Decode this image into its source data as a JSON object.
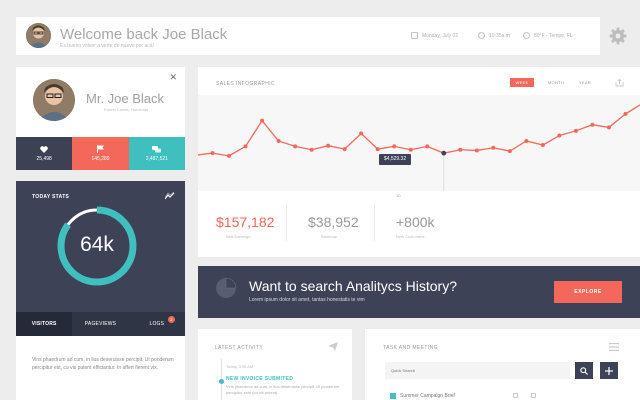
{
  "header": {
    "welcome": "Welcome back Joe Black",
    "subtitle": "Es bueno volver a verte de nuevo por acá!",
    "date": "Monday, July 02",
    "time": "10:35a.m",
    "weather": "80°F - Tempe, FL"
  },
  "profile": {
    "name": "Mr. Joe Black",
    "location": "Puerto Cortés, Honduras",
    "stats": [
      {
        "icon": "heart-icon",
        "value": "25,498"
      },
      {
        "icon": "flag-icon",
        "value": "145,289"
      },
      {
        "icon": "chat-icon",
        "value": "2,487,521"
      }
    ]
  },
  "today": {
    "title": "TODAY STATS",
    "value": "64k",
    "progress": 0.85,
    "tabs": [
      "VISITORS",
      "PAGEVIEWS",
      "LOGS"
    ],
    "active_tab": "VISITORS",
    "logs_badge": "2",
    "description": "Viris phaedrum ad cum, in lius deseruisse percipit. Ut ponderum percipitur est, cu vis putent efficiantur. In affert fierent vix."
  },
  "sales": {
    "title": "SALES INFOGRAPHIC",
    "periods": [
      "WEEK",
      "MONTH",
      "YEAR"
    ],
    "active_period": "WEEK",
    "tooltip": "$4,529.32",
    "x_label": "10",
    "kpis": [
      {
        "value": "$157,182",
        "label": "Total Earnings",
        "color": "#f3685a"
      },
      {
        "value": "$38,952",
        "label": "Revenue",
        "color": "#9a9a9a"
      },
      {
        "value": "+800k",
        "label": "New Customers",
        "color": "#9a9a9a"
      }
    ]
  },
  "chart_data": {
    "type": "line",
    "title": "SALES INFOGRAPHIC",
    "xlabel": "",
    "ylabel": "",
    "values": [
      47,
      50,
      46,
      60,
      98,
      68,
      60,
      55,
      61,
      56,
      79,
      56,
      60,
      55,
      60,
      50,
      55,
      54,
      58,
      53,
      68,
      62,
      76,
      83,
      92,
      88,
      108,
      123
    ],
    "ylim": [
      0,
      130
    ],
    "color": "#f3685a",
    "highlight_index": 15,
    "highlight_color": "#3d4257",
    "grid": false
  },
  "banner": {
    "title": "Want to search Analitycs History?",
    "subtitle": "Lorem ipsum dolor sit amet, tantas honestatis te vim",
    "button": "EXPLORE"
  },
  "activity": {
    "title": "LATEST ACTIVITY",
    "date": "Today, 3:30 AM",
    "headline": "NEW INVOICE SUBMITED",
    "text": "Viris phaedrum ad cum, in lius deseruisse percipit. Ut ponderum percipitur este (cu vis putent)."
  },
  "tasks": {
    "title": "TASK AND MEETING",
    "search_placeholder": "Quick Search",
    "item": "Summer Campaign Brief"
  },
  "colors": {
    "accent": "#f3685a",
    "teal": "#3fbfbd",
    "navy": "#3d4257"
  }
}
